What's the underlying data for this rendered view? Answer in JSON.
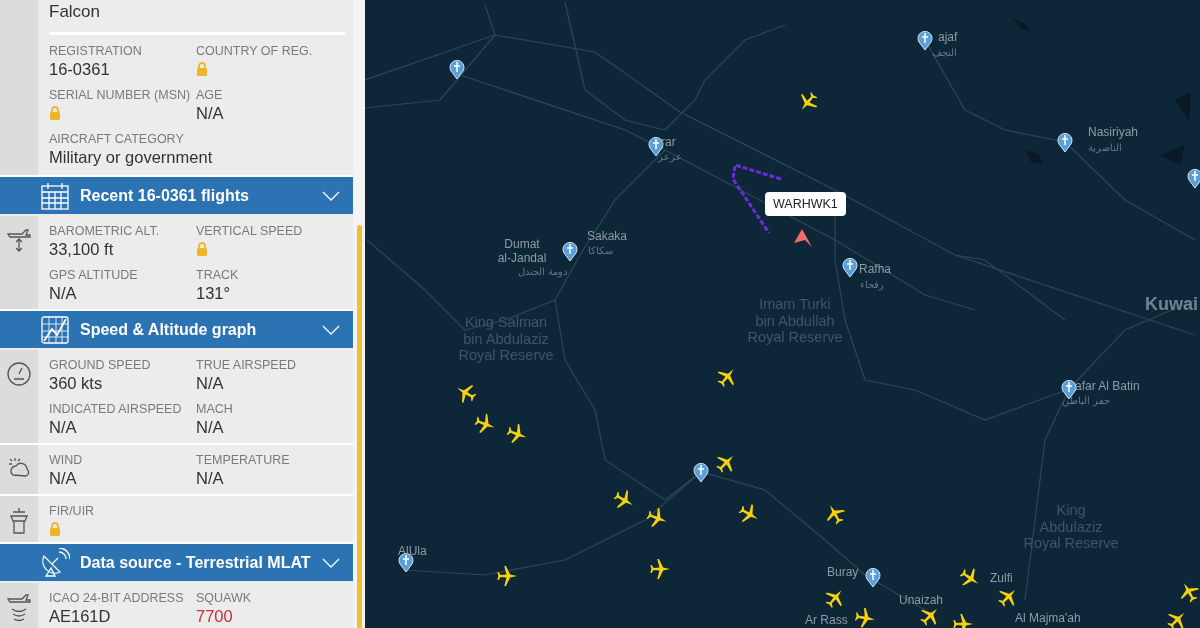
{
  "sidebar": {
    "heading_tail": "Falcon",
    "sections": [
      {
        "kind": "fields",
        "fields": [
          {
            "label": "REGISTRATION",
            "value": "16-0361",
            "locked": false,
            "alert": false
          },
          {
            "label": "COUNTRY OF REG.",
            "locked": true
          },
          {
            "label": "SERIAL NUMBER (MSN)",
            "locked": true
          },
          {
            "label": "AGE",
            "value": "N/A",
            "locked": false,
            "alert": false
          },
          {
            "label": "AIRCRAFT CATEGORY",
            "value": "Military or government",
            "locked": false,
            "alert": false
          }
        ]
      },
      {
        "kind": "header",
        "title": "Recent 16-0361 flights"
      },
      {
        "kind": "fields",
        "fields": [
          {
            "label": "BAROMETRIC ALT.",
            "value": "33,100 ft",
            "locked": false,
            "alert": false
          },
          {
            "label": "VERTICAL SPEED",
            "locked": true
          },
          {
            "label": "GPS ALTITUDE",
            "value": "N/A",
            "locked": false,
            "alert": false
          },
          {
            "label": "TRACK",
            "value": "131°",
            "locked": false,
            "alert": false
          }
        ]
      },
      {
        "kind": "header",
        "title": "Speed & Altitude graph"
      },
      {
        "kind": "fields",
        "fields": [
          {
            "label": "GROUND SPEED",
            "value": "360 kts",
            "locked": false,
            "alert": false
          },
          {
            "label": "TRUE AIRSPEED",
            "value": "N/A",
            "locked": false,
            "alert": false
          },
          {
            "label": "INDICATED AIRSPEED",
            "value": "N/A",
            "locked": false,
            "alert": false
          },
          {
            "label": "MACH",
            "value": "N/A",
            "locked": false,
            "alert": false
          }
        ]
      },
      {
        "kind": "fields",
        "fields": [
          {
            "label": "WIND",
            "value": "N/A",
            "locked": false,
            "alert": false
          },
          {
            "label": "TEMPERATURE",
            "value": "N/A",
            "locked": false,
            "alert": false
          }
        ]
      },
      {
        "kind": "fields",
        "fields": [
          {
            "label": "FIR/UIR",
            "locked": true
          }
        ]
      },
      {
        "kind": "header",
        "title": "Data source - Terrestrial MLAT"
      },
      {
        "kind": "fields",
        "fields": [
          {
            "label": "ICAO 24-BIT ADDRESS",
            "value": "AE161D",
            "locked": false,
            "alert": false
          },
          {
            "label": "SQUAWK",
            "value": "7700",
            "locked": false,
            "alert": true
          }
        ]
      }
    ]
  },
  "map": {
    "callsign_tag": "WARHWK1",
    "labels": [
      {
        "kind": "city",
        "lines": [
          "ajaf"
        ]
      },
      {
        "kind": "arabic",
        "lines": [
          "النجف"
        ]
      },
      {
        "kind": "city",
        "lines": [
          "rar"
        ]
      },
      {
        "kind": "arabic",
        "lines": [
          "عرعر"
        ]
      },
      {
        "kind": "city",
        "lines": [
          "Sakaka"
        ]
      },
      {
        "kind": "arabic",
        "lines": [
          "سكاكا"
        ]
      },
      {
        "kind": "city",
        "lines": [
          "Dumat",
          "al-Jandal"
        ]
      },
      {
        "kind": "arabic",
        "lines": [
          "دومة الجندل"
        ]
      },
      {
        "kind": "city",
        "lines": [
          "Rafha"
        ]
      },
      {
        "kind": "arabic",
        "lines": [
          "رفحاء"
        ]
      },
      {
        "kind": "city",
        "lines": [
          "Nasiriyah"
        ]
      },
      {
        "kind": "arabic",
        "lines": [
          "الناصرية"
        ]
      },
      {
        "kind": "country",
        "lines": [
          "Kuwai"
        ]
      },
      {
        "kind": "reserve",
        "lines": [
          "Imam Turki",
          "bin Abdullah",
          "Royal Reserve"
        ]
      },
      {
        "kind": "reserve",
        "lines": [
          "King Salman",
          "bin Abdulaziz",
          "Royal Reserve"
        ]
      },
      {
        "kind": "city",
        "lines": [
          "afar Al Batin"
        ]
      },
      {
        "kind": "arabic",
        "lines": [
          "حفر الباطن"
        ]
      },
      {
        "kind": "reserve",
        "lines": [
          "King",
          "Abdulaziz",
          "Royal Reserve"
        ]
      },
      {
        "kind": "city",
        "lines": [
          "AlUla"
        ]
      },
      {
        "kind": "city",
        "lines": [
          "Buray"
        ]
      },
      {
        "kind": "city",
        "lines": [
          "Unaizah"
        ]
      },
      {
        "kind": "city",
        "lines": [
          "Zulfi"
        ]
      },
      {
        "kind": "city",
        "lines": [
          "Ar Rass"
        ]
      },
      {
        "kind": "city",
        "lines": [
          "Al Majma'ah"
        ]
      }
    ]
  }
}
